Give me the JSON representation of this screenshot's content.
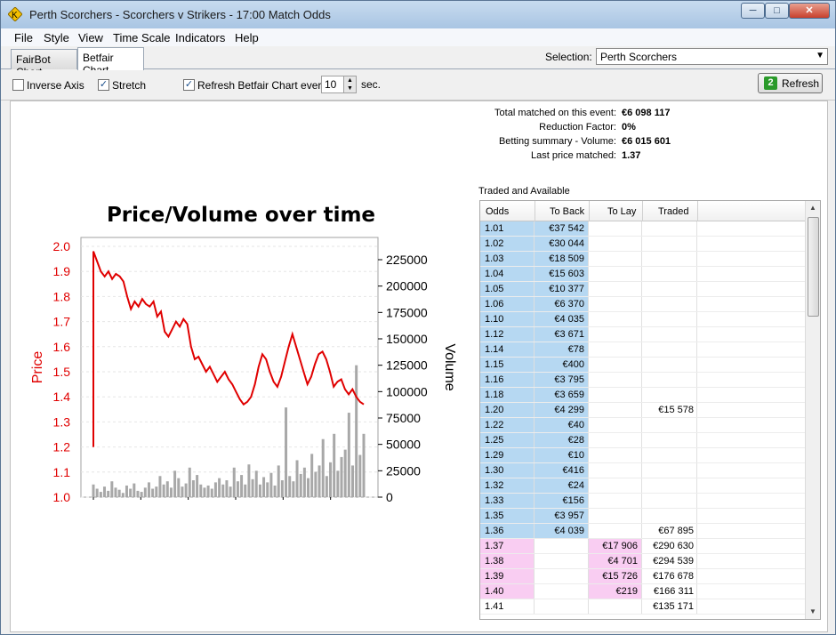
{
  "window": {
    "title": "Perth Scorchers - Scorchers v Strikers - 17:00 Match Odds",
    "min": "─",
    "max": "□",
    "close": "✕"
  },
  "menu": [
    "File",
    "Style",
    "View",
    "Time Scale",
    "Indicators",
    "Help"
  ],
  "tabs": [
    "FairBot Chart",
    "Betfair Chart"
  ],
  "selection": {
    "label": "Selection:",
    "value": "Perth Scorchers"
  },
  "options": {
    "inverse_axis": "Inverse Axis",
    "stretch": "Stretch",
    "refresh_label": "Refresh Betfair Chart every",
    "refresh_value": "10",
    "sec": "sec.",
    "inverse_checked": false,
    "stretch_checked": true,
    "refresh_checked": true
  },
  "refresh_button": "Refresh",
  "summary": [
    {
      "label": "Total matched on this event:",
      "value": "€6 098 117"
    },
    {
      "label": "Reduction Factor:",
      "value": "0%"
    },
    {
      "label": "Betting summary - Volume:",
      "value": "€6 015 601"
    },
    {
      "label": "Last price matched:",
      "value": "1.37"
    }
  ],
  "traded_label": "Traded and Available",
  "grid": {
    "headers": [
      "Odds",
      "To Back",
      "To Lay",
      "Traded"
    ],
    "rows": [
      {
        "odds": "1.01",
        "back": "€37 542",
        "lay": "",
        "traded": "",
        "side": "back"
      },
      {
        "odds": "1.02",
        "back": "€30 044",
        "lay": "",
        "traded": "",
        "side": "back"
      },
      {
        "odds": "1.03",
        "back": "€18 509",
        "lay": "",
        "traded": "",
        "side": "back"
      },
      {
        "odds": "1.04",
        "back": "€15 603",
        "lay": "",
        "traded": "",
        "side": "back"
      },
      {
        "odds": "1.05",
        "back": "€10 377",
        "lay": "",
        "traded": "",
        "side": "back"
      },
      {
        "odds": "1.06",
        "back": "€6 370",
        "lay": "",
        "traded": "",
        "side": "back"
      },
      {
        "odds": "1.10",
        "back": "€4 035",
        "lay": "",
        "traded": "",
        "side": "back"
      },
      {
        "odds": "1.12",
        "back": "€3 671",
        "lay": "",
        "traded": "",
        "side": "back"
      },
      {
        "odds": "1.14",
        "back": "€78",
        "lay": "",
        "traded": "",
        "side": "back"
      },
      {
        "odds": "1.15",
        "back": "€400",
        "lay": "",
        "traded": "",
        "side": "back"
      },
      {
        "odds": "1.16",
        "back": "€3 795",
        "lay": "",
        "traded": "",
        "side": "back"
      },
      {
        "odds": "1.18",
        "back": "€3 659",
        "lay": "",
        "traded": "",
        "side": "back"
      },
      {
        "odds": "1.20",
        "back": "€4 299",
        "lay": "",
        "traded": "€15 578",
        "side": "back"
      },
      {
        "odds": "1.22",
        "back": "€40",
        "lay": "",
        "traded": "",
        "side": "back"
      },
      {
        "odds": "1.25",
        "back": "€28",
        "lay": "",
        "traded": "",
        "side": "back"
      },
      {
        "odds": "1.29",
        "back": "€10",
        "lay": "",
        "traded": "",
        "side": "back"
      },
      {
        "odds": "1.30",
        "back": "€416",
        "lay": "",
        "traded": "",
        "side": "back"
      },
      {
        "odds": "1.32",
        "back": "€24",
        "lay": "",
        "traded": "",
        "side": "back"
      },
      {
        "odds": "1.33",
        "back": "€156",
        "lay": "",
        "traded": "",
        "side": "back"
      },
      {
        "odds": "1.35",
        "back": "€3 957",
        "lay": "",
        "traded": "",
        "side": "back"
      },
      {
        "odds": "1.36",
        "back": "€4 039",
        "lay": "",
        "traded": "€67 895",
        "side": "back"
      },
      {
        "odds": "1.37",
        "back": "",
        "lay": "€17 906",
        "traded": "€290 630",
        "side": "lay"
      },
      {
        "odds": "1.38",
        "back": "",
        "lay": "€4 701",
        "traded": "€294 539",
        "side": "lay"
      },
      {
        "odds": "1.39",
        "back": "",
        "lay": "€15 726",
        "traded": "€176 678",
        "side": "lay"
      },
      {
        "odds": "1.40",
        "back": "",
        "lay": "€219",
        "traded": "€166 311",
        "side": "lay"
      },
      {
        "odds": "1.41",
        "back": "",
        "lay": "",
        "traded": "€135 171",
        "side": "none"
      }
    ]
  },
  "chart_data": {
    "type": "line",
    "title": "Price/Volume over time",
    "ylabel": "Price",
    "y2label": "Volume",
    "ylim": [
      1.0,
      2.0
    ],
    "y2lim": [
      0,
      225000
    ],
    "yticks": [
      "2.0",
      "1.9",
      "1.8",
      "1.7",
      "1.6",
      "1.5",
      "1.4",
      "1.3",
      "1.2",
      "1.1",
      "1.0"
    ],
    "y2ticks": [
      "225000",
      "200000",
      "175000",
      "150000",
      "125000",
      "100000",
      "75000",
      "50000",
      "25000",
      "0"
    ],
    "price_color": "#e00000",
    "volume_color": "#a8a8a8",
    "price": [
      1.2,
      1.98,
      1.94,
      1.9,
      1.88,
      1.9,
      1.87,
      1.89,
      1.88,
      1.86,
      1.8,
      1.75,
      1.78,
      1.76,
      1.79,
      1.77,
      1.76,
      1.78,
      1.72,
      1.74,
      1.66,
      1.64,
      1.67,
      1.7,
      1.68,
      1.71,
      1.69,
      1.6,
      1.55,
      1.56,
      1.53,
      1.5,
      1.52,
      1.49,
      1.46,
      1.48,
      1.5,
      1.47,
      1.45,
      1.42,
      1.39,
      1.37,
      1.38,
      1.4,
      1.45,
      1.52,
      1.57,
      1.55,
      1.5,
      1.46,
      1.44,
      1.48,
      1.54,
      1.6,
      1.65,
      1.6,
      1.55,
      1.5,
      1.45,
      1.48,
      1.53,
      1.57,
      1.58,
      1.55,
      1.5,
      1.44,
      1.46,
      1.47,
      1.43,
      1.41,
      1.43,
      1.4,
      1.38,
      1.37
    ],
    "volume": [
      12000,
      8000,
      5000,
      10000,
      6000,
      15000,
      9000,
      7000,
      4000,
      11000,
      8000,
      13000,
      6000,
      5000,
      9000,
      14000,
      8000,
      10000,
      20000,
      12000,
      15000,
      9000,
      25000,
      18000,
      10000,
      13000,
      28000,
      16000,
      21000,
      12000,
      9000,
      11000,
      8000,
      14000,
      18000,
      12000,
      16000,
      10000,
      28000,
      15000,
      21000,
      12000,
      31000,
      17000,
      25000,
      12000,
      19000,
      14000,
      23000,
      11000,
      30000,
      16000,
      85000,
      20000,
      15000,
      35000,
      22000,
      28000,
      18000,
      41000,
      24000,
      30000,
      55000,
      20000,
      33000,
      60000,
      25000,
      38000,
      45000,
      80000,
      30000,
      125000,
      40000,
      60000
    ]
  }
}
